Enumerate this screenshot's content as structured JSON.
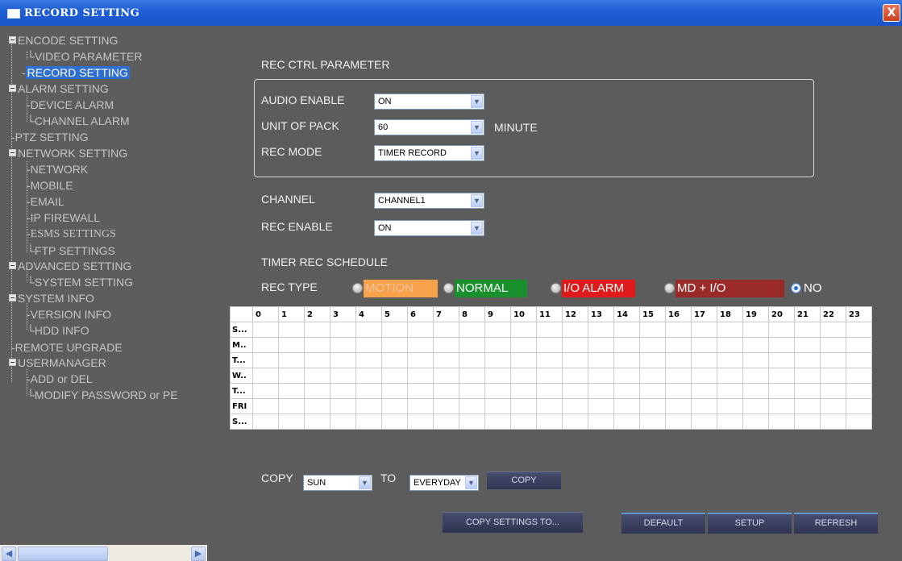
{
  "window": {
    "title": "RECORD SETTING",
    "close_label": "X"
  },
  "sidebar": {
    "items": [
      "ENCODE SETTING",
      "VIDEO PARAMETER",
      "RECORD SETTING",
      "ALARM SETTING",
      "DEVICE ALARM",
      "CHANNEL ALARM",
      "PTZ SETTING",
      "NETWORK SETTING",
      "NETWORK",
      "MOBILE",
      "EMAIL",
      "IP FIREWALL",
      "ESMS SETTINGS",
      "FTP SETTINGS",
      "ADVANCED SETTING",
      "SYSTEM SETTING",
      "SYSTEM INFO",
      "VERSION INFO",
      "HDD INFO",
      "REMOTE UPGRADE",
      "USERMANAGER",
      "ADD or DEL",
      "MODIFY PASSWORD or PE"
    ],
    "selected": "RECORD SETTING"
  },
  "rec_ctrl": {
    "heading": "REC CTRL PARAMETER",
    "audio_enable_label": "AUDIO ENABLE",
    "audio_enable_value": "ON",
    "unit_of_pack_label": "UNIT OF PACK",
    "unit_of_pack_value": "60",
    "unit_suffix": "MINUTE",
    "rec_mode_label": "REC MODE",
    "rec_mode_value": "TIMER RECORD"
  },
  "channel": {
    "label": "CHANNEL",
    "value": "CHANNEL1"
  },
  "rec_enable": {
    "label": "REC ENABLE",
    "value": "ON"
  },
  "schedule": {
    "heading": "TIMER REC SCHEDULE",
    "rec_type_label": "REC TYPE",
    "types": [
      {
        "label": "MOTION",
        "color": "#f7a24a",
        "text_color": "#f2c2a0",
        "checked": false
      },
      {
        "label": "NORMAL",
        "color": "#1a8f2e",
        "text_color": "#ffffff",
        "checked": false
      },
      {
        "label": "I/O ALARM",
        "color": "#e01a1a",
        "text_color": "#ffffff",
        "checked": false
      },
      {
        "label": "MD + I/O",
        "color": "#9a2a28",
        "text_color": "#ffffff",
        "checked": false
      },
      {
        "label": "NO",
        "color": "",
        "text_color": "#ffffff",
        "checked": true
      }
    ],
    "hours": [
      "0",
      "1",
      "2",
      "3",
      "4",
      "5",
      "6",
      "7",
      "8",
      "9",
      "10",
      "11",
      "12",
      "13",
      "14",
      "15",
      "16",
      "17",
      "18",
      "19",
      "20",
      "21",
      "22",
      "23"
    ],
    "days": [
      "S...",
      "M..",
      "T...",
      "W..",
      "T...",
      "FRI",
      "S..."
    ]
  },
  "copy": {
    "label": "COPY",
    "from_value": "SUN",
    "to_label": "TO",
    "to_value": "EVERYDAY",
    "button": "COPY"
  },
  "buttons": {
    "copy_settings": "COPY SETTINGS TO...",
    "default": "DEFAULT",
    "setup": "SETUP",
    "refresh": "REFRESH"
  },
  "colors": {
    "titlebar": "#1f5fd6",
    "selected": "#2f6fd1",
    "background": "#5c5c5c"
  }
}
